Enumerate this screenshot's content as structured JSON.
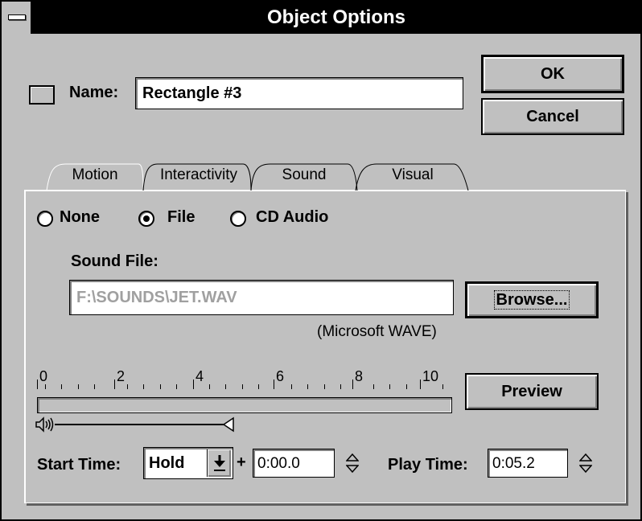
{
  "window": {
    "title": "Object Options"
  },
  "buttons": {
    "ok": "OK",
    "cancel": "Cancel",
    "browse": "Browse...",
    "preview": "Preview"
  },
  "name_field": {
    "label": "Name:",
    "value": "Rectangle #3"
  },
  "tabs": [
    {
      "label": "Motion",
      "active": false
    },
    {
      "label": "Interactivity",
      "active": false
    },
    {
      "label": "Sound",
      "active": true
    },
    {
      "label": "Visual",
      "active": false
    }
  ],
  "sound": {
    "source_options": [
      {
        "label": "None",
        "selected": false
      },
      {
        "label": "File",
        "selected": true
      },
      {
        "label": "CD Audio",
        "selected": false
      }
    ],
    "file_label": "Sound File:",
    "file_path": "F:\\SOUNDS\\JET.WAV",
    "file_format": "(Microsoft WAVE)",
    "timeline": {
      "ticks": [
        "0",
        "2",
        "4",
        "6",
        "8",
        "10"
      ],
      "range": [
        0,
        10.5
      ]
    },
    "volume_level": 1.0,
    "start_time": {
      "label": "Start Time:",
      "mode": "Hold",
      "plus": "+",
      "offset": "0:00.0"
    },
    "play_time": {
      "label": "Play Time:",
      "value": "0:05.2"
    }
  }
}
